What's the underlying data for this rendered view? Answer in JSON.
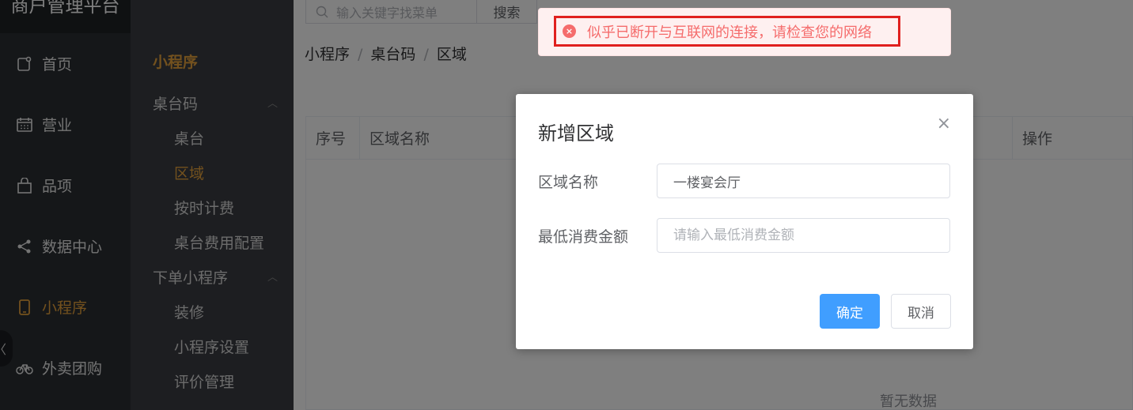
{
  "brand": "商户管理平台",
  "nav": [
    {
      "label": "首页",
      "icon": "home-icon",
      "active": false
    },
    {
      "label": "营业",
      "icon": "calendar-icon",
      "active": false
    },
    {
      "label": "品项",
      "icon": "bag-icon",
      "active": false
    },
    {
      "label": "数据中心",
      "icon": "share-icon",
      "active": false
    },
    {
      "label": "小程序",
      "icon": "phone-icon",
      "active": true
    },
    {
      "label": "外卖团购",
      "icon": "bike-icon",
      "active": false
    }
  ],
  "collapse_glyph": "〈",
  "subnav": {
    "title": "小程序",
    "groups": [
      {
        "label": "桌台码",
        "arrow": "︿",
        "items": [
          "桌台",
          "区域",
          "按时计费",
          "桌台费用配置"
        ],
        "active_index": 1
      },
      {
        "label": "下单小程序",
        "arrow": "︿",
        "items": [
          "装修",
          "小程序设置",
          "评价管理"
        ]
      }
    ]
  },
  "topbar": {
    "search_placeholder": "输入关键字找菜单",
    "search_button": "搜索"
  },
  "breadcrumb": [
    "小程序",
    "桌台码",
    "区域"
  ],
  "breadcrumb_sep": "/",
  "table": {
    "headers": [
      "序号",
      "区域名称",
      "操作"
    ],
    "empty_text": "暂无数据"
  },
  "dialog": {
    "title": "新增区域",
    "close_glyph": "×",
    "fields": [
      {
        "label": "区域名称",
        "value": "一楼宴会厅",
        "placeholder": ""
      },
      {
        "label": "最低消费金额",
        "value": "",
        "placeholder": "请输入最低消费金额"
      }
    ],
    "confirm": "确定",
    "cancel": "取消"
  },
  "toast": {
    "icon_glyph": "×",
    "text": "似乎已断开与互联网的连接，请检查您的网络"
  },
  "colors": {
    "accent": "#e6a23c",
    "primary": "#409eff",
    "error": "#f56c6c"
  }
}
